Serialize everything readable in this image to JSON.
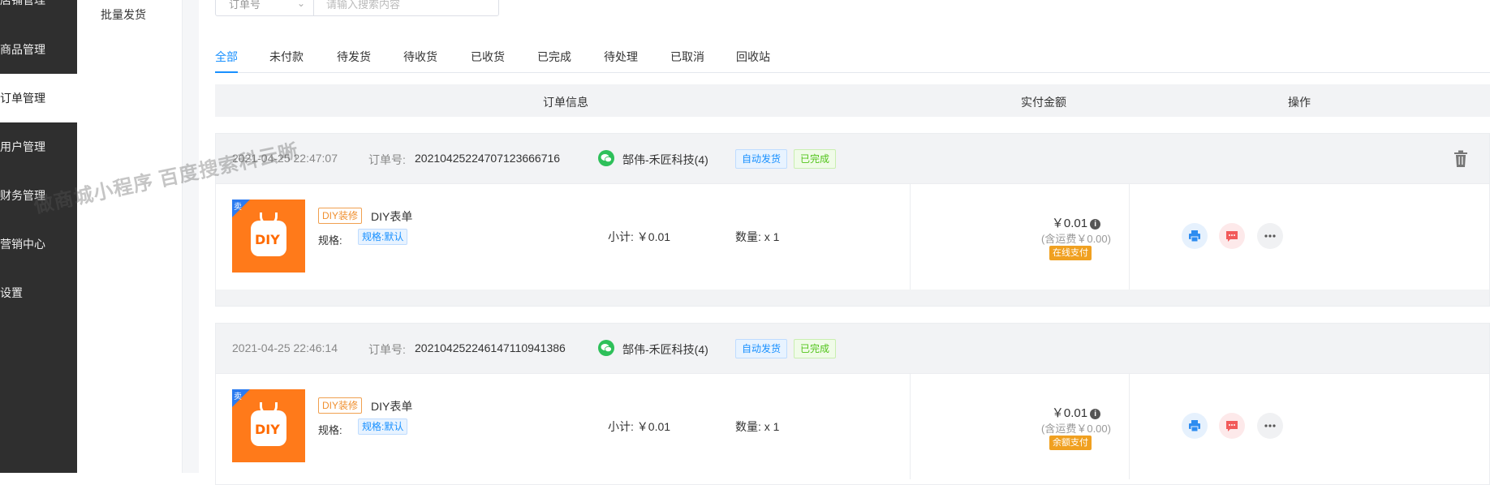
{
  "left_nav": {
    "items": [
      {
        "label": "店铺管理"
      },
      {
        "label": "商品管理"
      },
      {
        "label": "订单管理",
        "active": true
      },
      {
        "label": "用户管理"
      },
      {
        "label": "财务管理"
      },
      {
        "label": "营销中心"
      },
      {
        "label": "设置"
      }
    ]
  },
  "sub_nav": {
    "item": "批量发货"
  },
  "search": {
    "select_value": "订单号",
    "placeholder": "请输入搜索内容"
  },
  "tabs": [
    "全部",
    "未付款",
    "待发货",
    "待收货",
    "已收货",
    "已完成",
    "待处理",
    "已取消",
    "回收站"
  ],
  "active_tab": "全部",
  "table_header": {
    "order_info": "订单信息",
    "amount": "实付金额",
    "ops": "操作"
  },
  "orders": [
    {
      "datetime": "2021-04-25 22:47:07",
      "order_no_label": "订单号:",
      "order_no": "20210425224707123666716",
      "buyer": "郜伟-禾匠科技(4)",
      "tag_delivery": "自动发货",
      "tag_status": "已完成",
      "thumb_corner": "卖",
      "thumb_text": "DIY",
      "diy_tag": "DIY装修",
      "product_name": "DIY表单",
      "spec_label": "规格:",
      "spec_value": "规格:默认",
      "subtotal": "小计: ￥0.01",
      "quantity": "数量: x 1",
      "price": "￥0.01",
      "shipping": "(含运费￥0.00)",
      "pay_method": "在线支付"
    },
    {
      "datetime": "2021-04-25 22:46:14",
      "order_no_label": "订单号:",
      "order_no": "20210425224614711094138­6",
      "buyer": "郜伟-禾匠科技(4)",
      "tag_delivery": "自动发货",
      "tag_status": "已完成",
      "thumb_corner": "卖",
      "thumb_text": "DIY",
      "diy_tag": "DIY装修",
      "product_name": "DIY表单",
      "spec_label": "规格:",
      "spec_value": "规格:默认",
      "subtotal": "小计: ￥0.01",
      "quantity": "数量: x 1",
      "price": "￥0.01",
      "shipping": "(含运费￥0.00)",
      "pay_method": "余额支付"
    }
  ],
  "watermark": "做商城小程序 百度搜索科云晰",
  "colors": {
    "accent": "#1890ff",
    "nav_bg": "#2f2f2f",
    "success": "#52c41a",
    "pay_tag": "#f0a020",
    "thumb": "#ff7a1a"
  }
}
